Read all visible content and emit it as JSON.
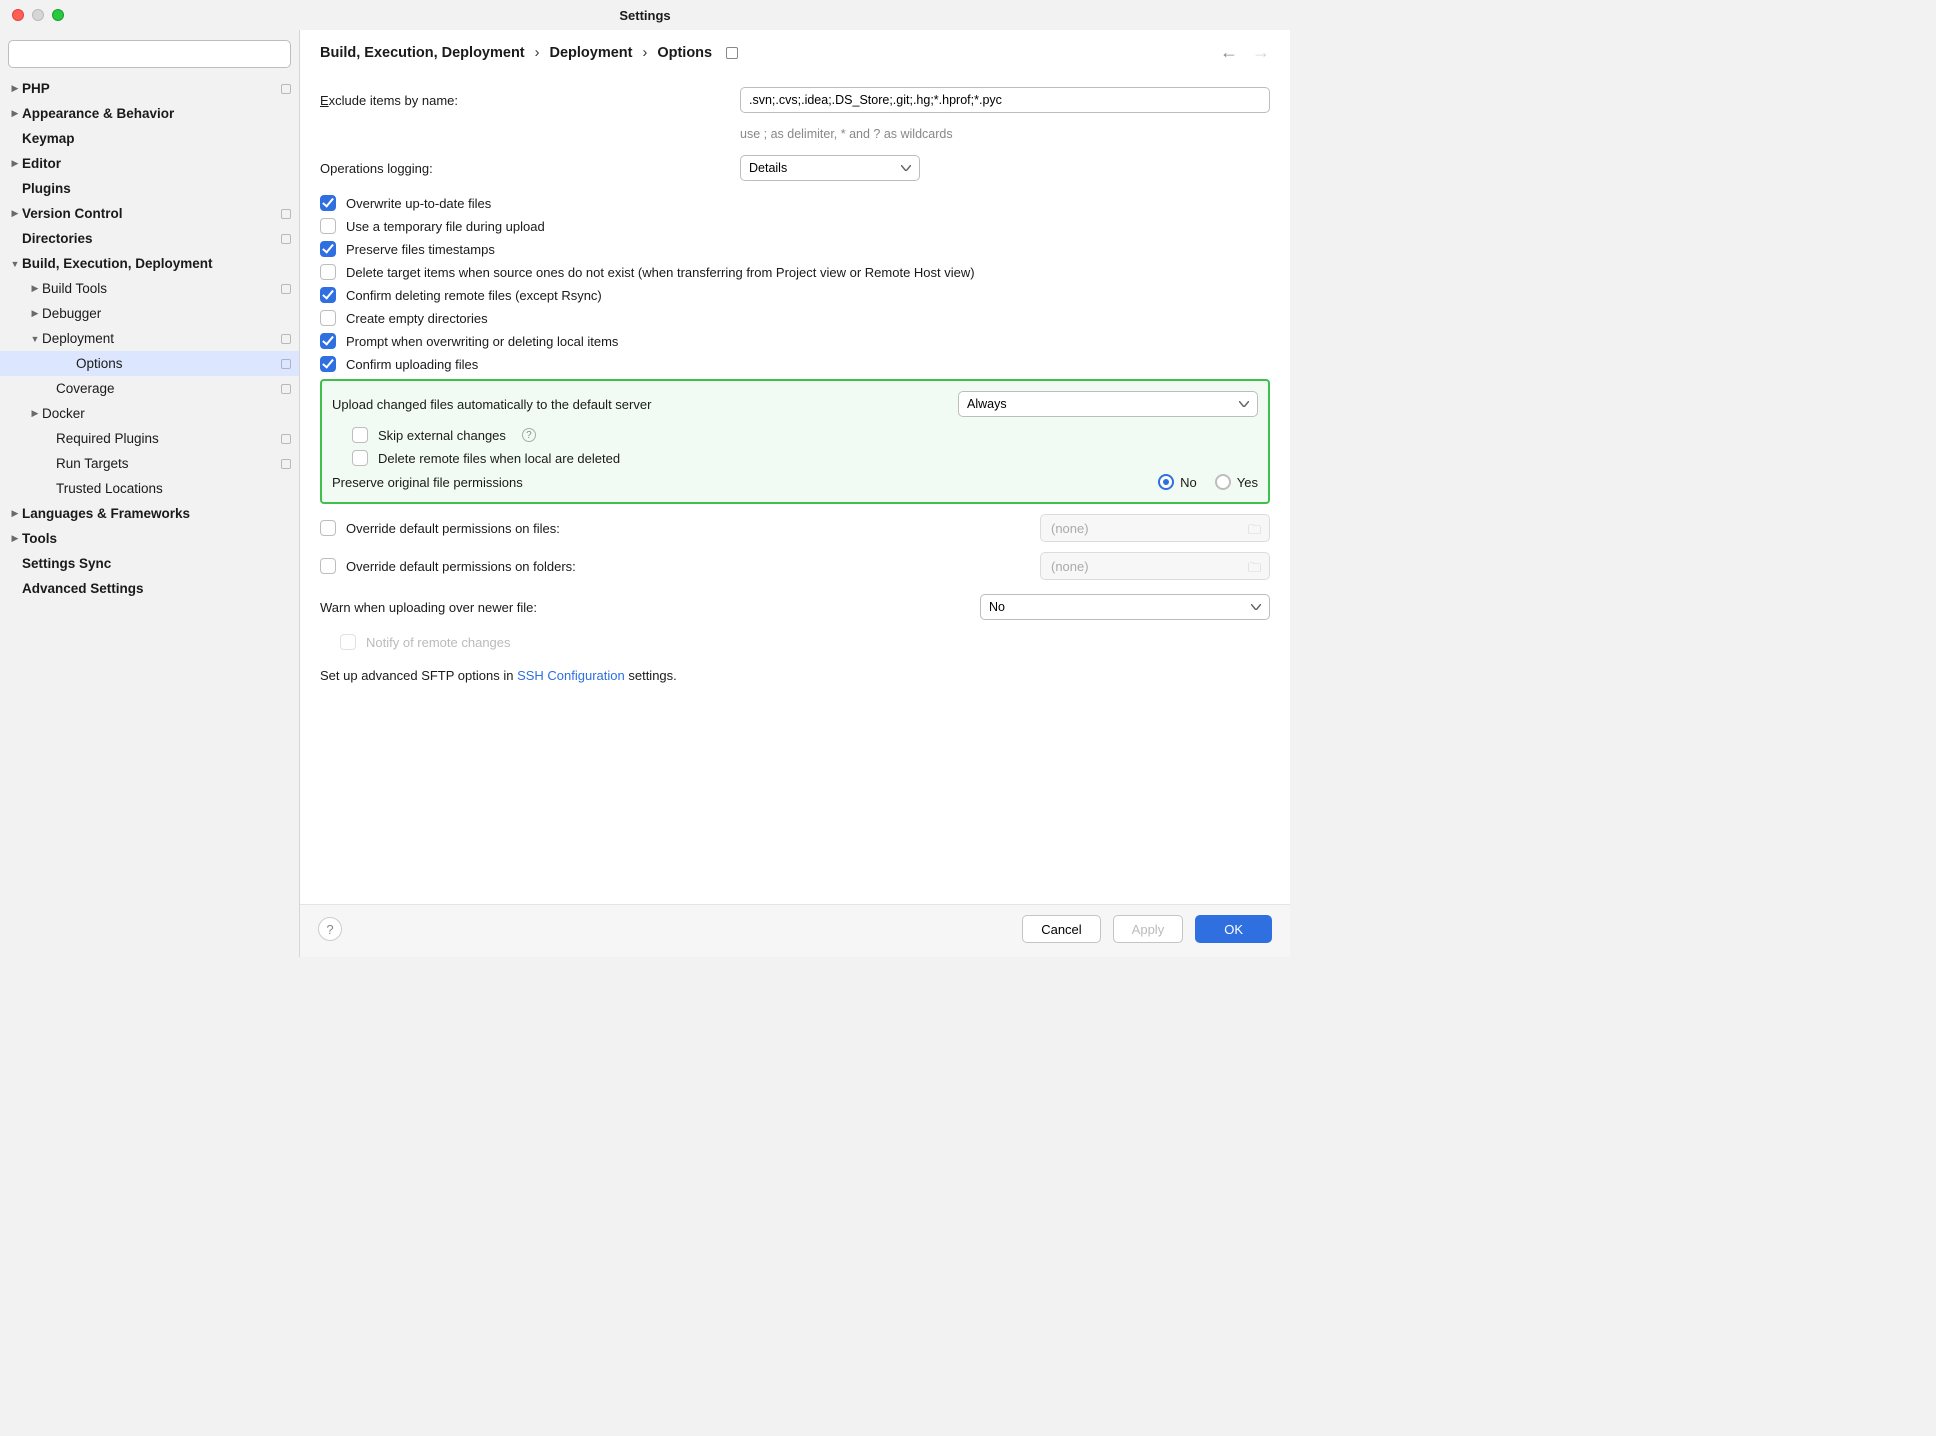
{
  "window": {
    "title": "Settings"
  },
  "search": {
    "placeholder": ""
  },
  "sidebar": {
    "php": "PHP",
    "appearance": "Appearance & Behavior",
    "keymap": "Keymap",
    "editor": "Editor",
    "plugins": "Plugins",
    "vcs": "Version Control",
    "directories": "Directories",
    "bed": "Build, Execution, Deployment",
    "buildtools": "Build Tools",
    "debugger": "Debugger",
    "deployment": "Deployment",
    "options": "Options",
    "coverage": "Coverage",
    "docker": "Docker",
    "reqplugins": "Required Plugins",
    "runtargets": "Run Targets",
    "trusted": "Trusted Locations",
    "langs": "Languages & Frameworks",
    "tools": "Tools",
    "sync": "Settings Sync",
    "advanced": "Advanced Settings"
  },
  "crumbs": {
    "c1": "Build, Execution, Deployment",
    "c2": "Deployment",
    "c3": "Options"
  },
  "form": {
    "exclude_lbl_pre": "E",
    "exclude_lbl_post": "xclude items by name:",
    "exclude_val": ".svn;.cvs;.idea;.DS_Store;.git;.hg;*.hprof;*.pyc",
    "exclude_hint": "use ; as delimiter, * and ? as wildcards",
    "ops_lbl": "Operations logging:",
    "ops_val": "Details",
    "cb_overwrite": "Overwrite up-to-date files",
    "cb_tempfile": "Use a temporary file during upload",
    "cb_timestamps": "Preserve files timestamps",
    "cb_deletetarget": "Delete target items when source ones do not exist (when transferring from Project view or Remote Host view)",
    "cb_confirmdel": "Confirm deleting remote files (except Rsync)",
    "cb_empty": "Create empty directories",
    "cb_prompt": "Prompt when overwriting or deleting local items",
    "cb_confirmup": "Confirm uploading files",
    "upload_lbl": "Upload changed files automatically to the default server",
    "upload_val": "Always",
    "skip_ext": "Skip external changes",
    "del_remote": "Delete remote files when local are deleted",
    "preserve_lbl": "Preserve original file permissions",
    "radio_no": "No",
    "radio_yes": "Yes",
    "override_files": "Override default permissions on files:",
    "override_folders": "Override default permissions on folders:",
    "perm_none": "(none)",
    "warn_lbl": "Warn when uploading over newer file:",
    "warn_val": "No",
    "notify": "Notify of remote changes",
    "sftp_pre": "Set up advanced SFTP options in ",
    "sftp_link": "SSH Configuration",
    "sftp_post": " settings."
  },
  "footer": {
    "cancel": "Cancel",
    "apply": "Apply",
    "ok": "OK"
  }
}
